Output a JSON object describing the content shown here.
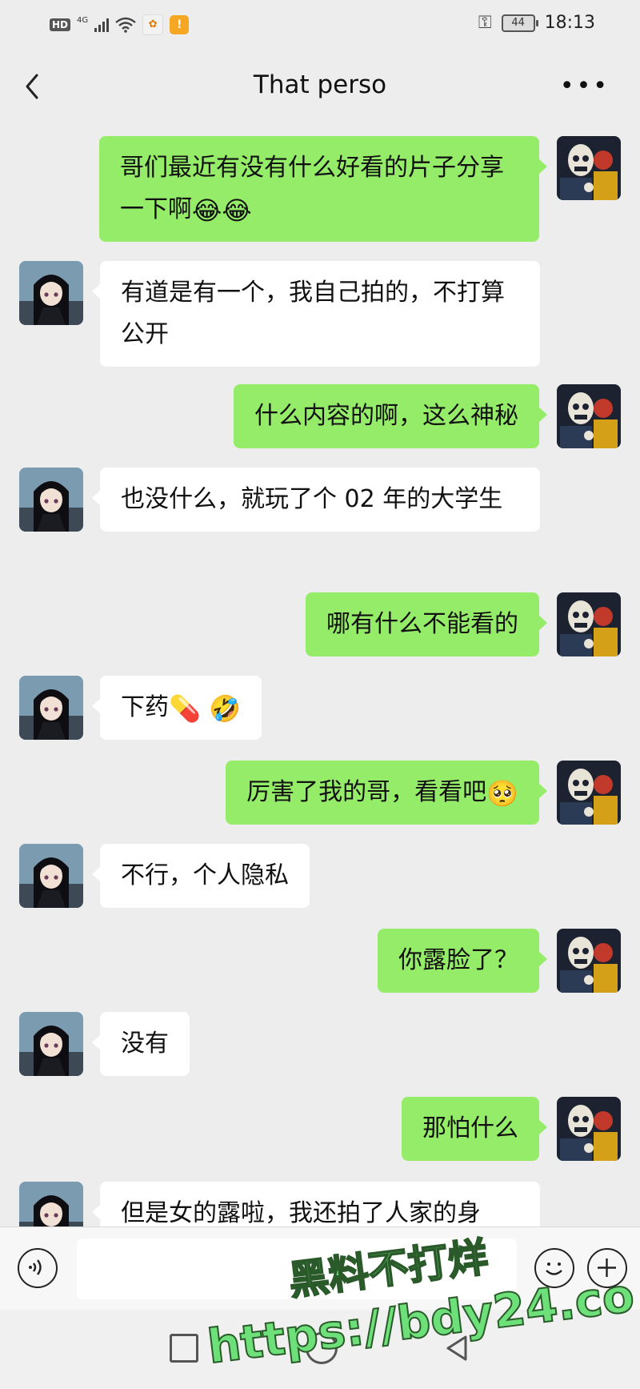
{
  "status_bar": {
    "hd": "HD",
    "network": "4G",
    "battery": "44",
    "time": "18:13"
  },
  "header": {
    "title": "That perso",
    "more": "•••"
  },
  "messages": [
    {
      "side": "right",
      "text": "哥们最近有没有什么好看的片子分享一下啊",
      "emojis": "😂😂"
    },
    {
      "side": "left",
      "text": "有道是有一个，我自己拍的，不打算公开",
      "emojis": ""
    },
    {
      "side": "right",
      "text": "什么内容的啊，这么神秘",
      "emojis": ""
    },
    {
      "side": "left",
      "text": "也没什么，就玩了个 02 年的大学生",
      "emojis": ""
    },
    {
      "side": "right",
      "text": "哪有什么不能看的",
      "emojis": ""
    },
    {
      "side": "left",
      "text": "下药",
      "emojis": "💊 🤣"
    },
    {
      "side": "right",
      "text": "厉害了我的哥，看看吧",
      "emojis": "🥺"
    },
    {
      "side": "left",
      "text": "不行，个人隐私",
      "emojis": ""
    },
    {
      "side": "right",
      "text": "你露脸了？",
      "emojis": ""
    },
    {
      "side": "left",
      "text": "没有",
      "emojis": ""
    },
    {
      "side": "right",
      "text": "那怕什么",
      "emojis": ""
    },
    {
      "side": "left",
      "text": "但是女的露啦，我还拍了人家的身",
      "emojis": ""
    }
  ],
  "watermark": {
    "line1": "黑料不打烊",
    "line2": "https://bdy24.co"
  },
  "colors": {
    "background": "#ededed",
    "sent_bubble": "#95ec69",
    "received_bubble": "#ffffff"
  }
}
